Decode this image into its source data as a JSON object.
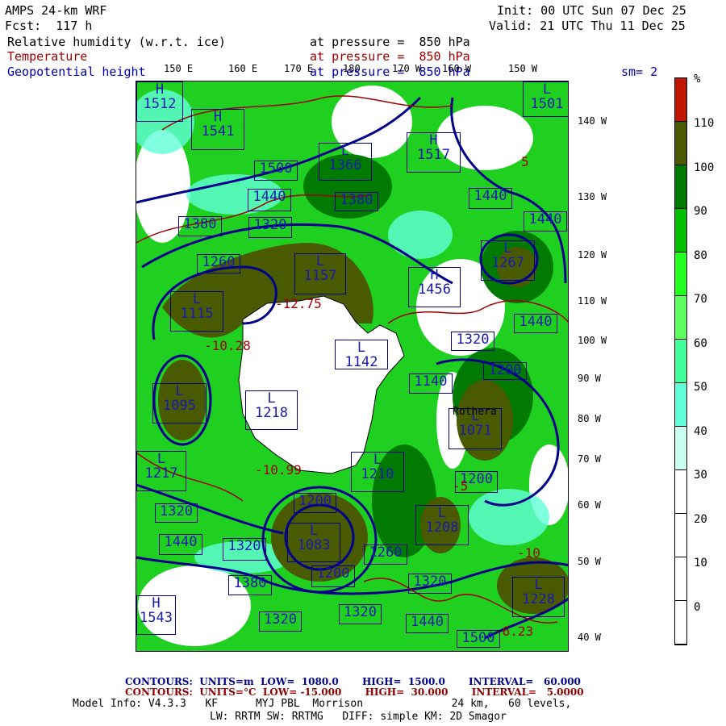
{
  "header": {
    "model": "AMPS 24-km WRF",
    "forecast": "Fcst:  117 h",
    "init": "Init: 00 UTC Sun 07 Dec 25",
    "valid": "Valid: 21 UTC Thu 11 Dec 25",
    "fields": [
      {
        "name": "Relative humidity (w.r.t. ice)",
        "level": "at pressure =  850 hPa"
      },
      {
        "name": "Temperature",
        "level": "at pressure =  850 hPa"
      },
      {
        "name": "Geopotential height",
        "level": "at pressure =  850 hPa"
      }
    ],
    "smoothing": "sm= 2"
  },
  "longitude_labels": [
    "150 E",
    "160 E",
    "170 E",
    "180",
    "170 W",
    "160 W",
    "150 W"
  ],
  "latitude_labels": [
    "140 W",
    "130 W",
    "120 W",
    "110 W",
    "100 W",
    "90 W",
    "80 W",
    "70 W",
    "60 W",
    "50 W",
    "40 W"
  ],
  "colorbar": {
    "unit": "%",
    "colors": [
      "#c01800",
      "#4a5a00",
      "#007a00",
      "#00c000",
      "#20ff20",
      "#60ff60",
      "#40ff9a",
      "#60ffd8",
      "#c8fff0",
      "#ffffff",
      "#ffffff",
      "#ffffff",
      "#ffffff"
    ],
    "labels": [
      "110",
      "100",
      "90",
      "80",
      "70",
      "60",
      "50",
      "40",
      "30",
      "20",
      "10",
      "0"
    ]
  },
  "height_labels": [
    {
      "sym": "H",
      "val": "1512"
    },
    {
      "sym": "H",
      "val": "1541"
    },
    {
      "sym": "",
      "val": "1500"
    },
    {
      "sym": "L",
      "val": "1366"
    },
    {
      "sym": "H",
      "val": "1517"
    },
    {
      "sym": "L",
      "val": "1501"
    },
    {
      "sym": "",
      "val": "1440"
    },
    {
      "sym": "",
      "val": "1380"
    },
    {
      "sym": "",
      "val": "1440"
    },
    {
      "sym": "",
      "val": "1380"
    },
    {
      "sym": "",
      "val": "1320"
    },
    {
      "sym": "",
      "val": "1440"
    },
    {
      "sym": "",
      "val": "1260"
    },
    {
      "sym": "L",
      "val": "1157"
    },
    {
      "sym": "H",
      "val": "1456"
    },
    {
      "sym": "L",
      "val": "1267"
    },
    {
      "sym": "L",
      "val": "1115"
    },
    {
      "sym": "",
      "val": "1440"
    },
    {
      "sym": "L",
      "val": "1142"
    },
    {
      "sym": "",
      "val": "1320"
    },
    {
      "sym": "",
      "val": "1200"
    },
    {
      "sym": "",
      "val": "1140"
    },
    {
      "sym": "L",
      "val": "1095"
    },
    {
      "sym": "L",
      "val": "1218"
    },
    {
      "sym": "L",
      "val": "1071"
    },
    {
      "sym": "L",
      "val": "1217"
    },
    {
      "sym": "L",
      "val": "1210"
    },
    {
      "sym": "",
      "val": "1200"
    },
    {
      "sym": "",
      "val": "1320"
    },
    {
      "sym": "",
      "val": "1200"
    },
    {
      "sym": "L",
      "val": "1208"
    },
    {
      "sym": "L",
      "val": "1083"
    },
    {
      "sym": "",
      "val": "1440"
    },
    {
      "sym": "",
      "val": "1320"
    },
    {
      "sym": "",
      "val": "1260"
    },
    {
      "sym": "",
      "val": "1380"
    },
    {
      "sym": "",
      "val": "1200"
    },
    {
      "sym": "",
      "val": "1320"
    },
    {
      "sym": "L",
      "val": "1228"
    },
    {
      "sym": "H",
      "val": "1543"
    },
    {
      "sym": "",
      "val": "1320"
    },
    {
      "sym": "",
      "val": "1320"
    },
    {
      "sym": "",
      "val": "1440"
    },
    {
      "sym": "",
      "val": "1500"
    }
  ],
  "temperature_labels": [
    "-12.75",
    "-10.28",
    "-10.99",
    "-6.23",
    "-10",
    "-5",
    "5"
  ],
  "station_label": "Rothera",
  "footer": {
    "height_contours": "CONTOURS:  UNITS=m  LOW=  1080.0       HIGH=  1500.0       INTERVAL=   60.000",
    "temp_contours": "CONTOURS:  UNITS=°C  LOW= -15.000       HIGH=  30.000       INTERVAL=   5.0000",
    "model_info": "Model Info: V4.3.3   KF      MYJ PBL  Morrison              24 km,   60 levels,",
    "model_info2": "LW: RRTM SW: RRTMG   DIFF: simple KM: 2D Smagor"
  }
}
